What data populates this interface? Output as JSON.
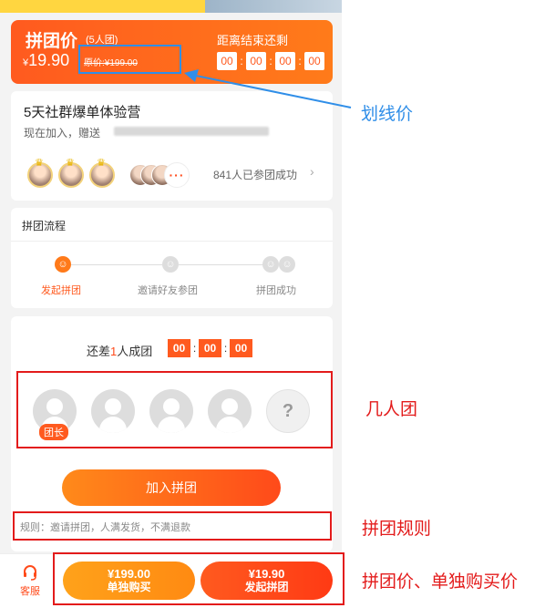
{
  "price_banner": {
    "title": "拼团价",
    "team_size": "(5人团)",
    "currency": "¥",
    "price": "19.90",
    "original_price": "原价:¥199.00",
    "countdown_label": "距离结束还剩",
    "countdown": [
      "00",
      "00",
      "00",
      "00"
    ]
  },
  "promo": {
    "title": "5天社群爆单体验营",
    "subtitle": "现在加入，赠送",
    "joined_text": "841人已参团成功"
  },
  "flow": {
    "title": "拼团流程",
    "steps": [
      "发起拼团",
      "邀请好友参团",
      "拼团成功"
    ]
  },
  "team": {
    "short_prefix": "还差",
    "short_count": "1",
    "short_suffix": "人成团",
    "timer": [
      "00",
      "00",
      "00"
    ],
    "leader_label": "团长",
    "unknown_member": "?",
    "join_button": "加入拼团",
    "rule": "规则：邀请拼团，人满发货，不满退款"
  },
  "bottom_bar": {
    "service_label": "客服",
    "solo_price": "¥199.00",
    "solo_label": "单独购买",
    "group_price": "¥19.90",
    "group_label": "发起拼团"
  },
  "annotations": {
    "strike_price": "划线价",
    "team_size": "几人团",
    "group_rules": "拼团规则",
    "prices": "拼团价、单独购买价"
  },
  "colors": {
    "accent": "#ff5a1f",
    "annotation_red": "#e31b1b",
    "annotation_blue": "#2f8ee8"
  }
}
